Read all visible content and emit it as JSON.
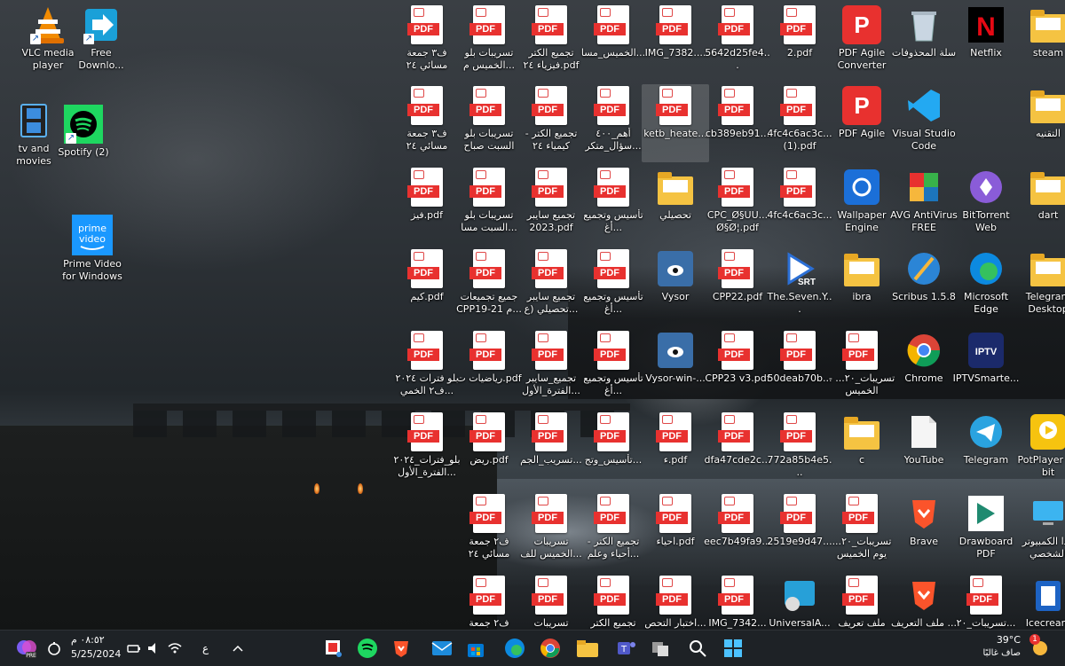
{
  "colors": {
    "pdf_red": "#e8312f",
    "taskbar_bg": "#1e2226",
    "folder": "#f5c342"
  },
  "left_icons": [
    {
      "name": "vlc-media-player-icon",
      "label": "VLC media player",
      "icon": "vlc"
    },
    {
      "name": "free-download-icon",
      "label": "Free Downlo...",
      "icon": "download"
    },
    {
      "name": "tv-and-movies-icon",
      "label": "tv and movies",
      "icon": "film"
    },
    {
      "name": "spotify-icon",
      "label": "Spotify (2)",
      "icon": "spotify"
    },
    {
      "name": "prime-video-icon",
      "label": "Prime Video for Windows",
      "icon": "prime"
    }
  ],
  "grid": [
    [
      "ف٣ جمعة مسائي ٢٤",
      "تسريبات بلو الخميس م...",
      "تجميع الكتر فيزياء ٢٤.pdf",
      "الخميس_مسا...",
      "IMG_7382....",
      "5642d25fe4...",
      "2.pdf",
      "PDF Agile Converter",
      "سلة المحذوفات",
      "Netflix",
      "steam"
    ],
    [
      "ف٣ جمعة مسائي ٢٤",
      "تسريبات بلو السبت صباح",
      "تجميع الكتر - كيمياء ٢٤",
      "أهم_٤٠٠ سؤال_متكر...",
      "ketb_heate...",
      "cb389eb91...",
      "4fc4c6ac3c... (1).pdf",
      "PDF Agile",
      "Visual Studio Code",
      "",
      "التقنيه"
    ],
    [
      "فيز.pdf",
      "تسريبات بلو السبت مسا...",
      "تجميع سايبر 2023.pdf",
      "تأسيس وتجميع أغ...",
      "تحصيلي",
      "CPC_Ø§UU... Ø§Ø¦.pdf",
      "4fc4c6ac3c...",
      "Wallpaper Engine",
      "AVG AntiVirus FREE",
      "BitTorrent Web",
      "dart"
    ],
    [
      "كيم.pdf",
      "جميع تجميعات CPP19-21 م...",
      "تجميع سايبر تحصيلي (ع...",
      "تأسيس وتجميع أغ...",
      "Vysor",
      "CPP22.pdf",
      "The.Seven.Y...",
      "ibra",
      "Scribus 1.5.8",
      "Microsoft Edge",
      "Telegram Desktop"
    ],
    [
      "بلو فترات ٢٠٢٤ ف٢ الخمي...",
      "رياضيات ت.pdf",
      "تجميع_سايبر الفترة_الأول...",
      "تأسيس وتجميع أغ...",
      "Vysor-win-...",
      "CPP23 v3.pdf",
      "50deab70b...",
      "تسريبات_٢٠... - الخميس",
      "Chrome",
      "IPTVSmarte...",
      ""
    ],
    [
      "بلو_فترات_٢٠٢٤ الفترة_الأول...",
      "ريض.pdf",
      "تسريب_الجم...",
      "تأسيس_وتج...",
      "ء.pdf",
      "dfa47cde2c...",
      "772a85b4e5...",
      "c",
      "YouTube",
      "Telegram",
      "PotPlayer 64 bit"
    ],
    [
      "",
      "ف٢ جمعة مسائي ٢٤",
      "تسريبات الخميس للف...",
      "تجميع الكتر - أحياء وعلم...",
      "احياء.pdf",
      "eec7b49fa9...",
      "2519e9d47...",
      "تسريبات_٢٠... يوم الخميس",
      "Brave",
      "Drawboard PDF",
      "هذا الكمبيوتر الشخصي"
    ],
    [
      "",
      "ف٢ جمعة",
      "تسريبات",
      "تجميع الكتر",
      "اختبار التحص...",
      "IMG_7342...",
      "UniversalA...",
      "ملف تعريف تر...",
      "ملف التعريف ...",
      "تسريبات_٢٠...",
      "Icecream"
    ]
  ],
  "taskbar": {
    "time": "٠٨:٥٢ م",
    "date": "5/25/2024",
    "lang": "ع",
    "temperature": "39°C",
    "weather_desc": "صاف غالبًا",
    "notif_count": "1"
  }
}
